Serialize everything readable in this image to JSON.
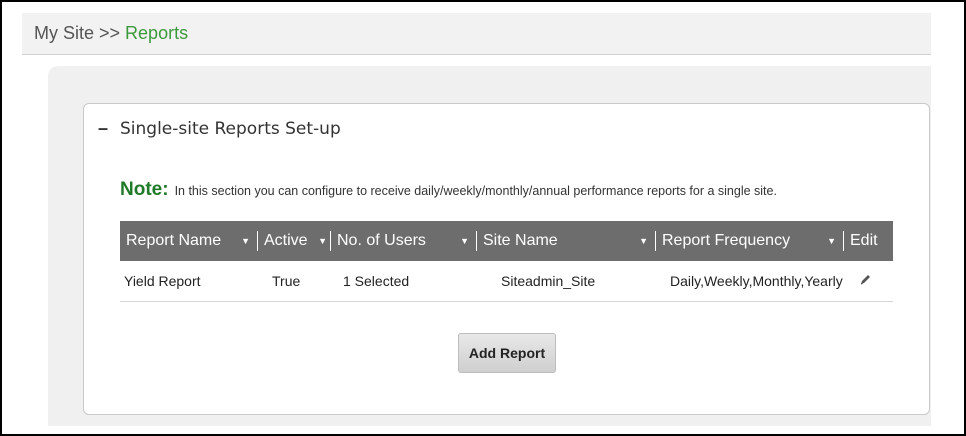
{
  "breadcrumb": {
    "root": "My Site",
    "separator": ">>",
    "current": "Reports"
  },
  "panel": {
    "toggle": "–",
    "title": "Single-site Reports Set-up",
    "note_label": "Note:",
    "note_text": "In this section you can configure to receive daily/weekly/monthly/annual performance reports for a single site."
  },
  "table": {
    "columns": [
      {
        "label": "Report Name",
        "caret": "▼"
      },
      {
        "label": "Active",
        "caret": "▼"
      },
      {
        "label": "No. of Users",
        "caret": "▼"
      },
      {
        "label": "Site Name",
        "caret": "▼"
      },
      {
        "label": "Report Frequency",
        "caret": "▼"
      },
      {
        "label": "Edit"
      }
    ],
    "rows": [
      {
        "report_name": "Yield Report",
        "active": "True",
        "users": "1 Selected",
        "site_name": "Siteadmin_Site",
        "frequency": "Daily,Weekly,Monthly,Yearly",
        "edit_icon": "pencil-icon"
      }
    ]
  },
  "actions": {
    "add_report_label": "Add Report"
  },
  "colors": {
    "breadcrumb_current": "#3c9a3c",
    "note_label": "#1f7a2a",
    "table_header_bg": "#6d6d6d"
  }
}
